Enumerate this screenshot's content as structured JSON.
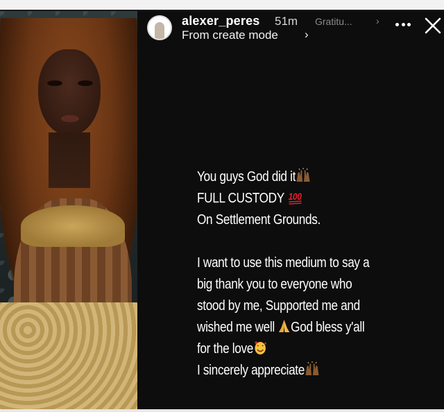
{
  "story": {
    "username": "alexer_peres",
    "timestamp": "51m",
    "music_title": "Gratitu...",
    "music_chevron": "›",
    "subtitle": "From create mode",
    "subtitle_chevron": "›",
    "caption": {
      "line1": "You guys God did it",
      "line2": "FULL CUSTODY",
      "line3": "On Settlement Grounds.",
      "line4": "I want to use this medium to say a",
      "line5": "big thank you to everyone who",
      "line6": "stood by me, Supported me and",
      "line7a": "wished me well",
      "line7b": "God bless y'all",
      "line8": "for the love",
      "line9": "I sincerely appreciate"
    }
  },
  "icons": {
    "avatar": "profile-avatar",
    "more": "more-dots-icon",
    "close": "close-icon",
    "raising_hands": "raising-hands-emoji",
    "hundred": "hundred-points-emoji",
    "praying_hands": "praying-hands-emoji",
    "smiling_hearts": "smiling-face-with-hearts-emoji"
  },
  "colors": {
    "story_background": "#0d0d0d",
    "text_primary": "#ffffff",
    "text_muted": "#8a8a8a",
    "hundred_red": "#e0202a",
    "emoji_skin": "#8a5a30"
  }
}
